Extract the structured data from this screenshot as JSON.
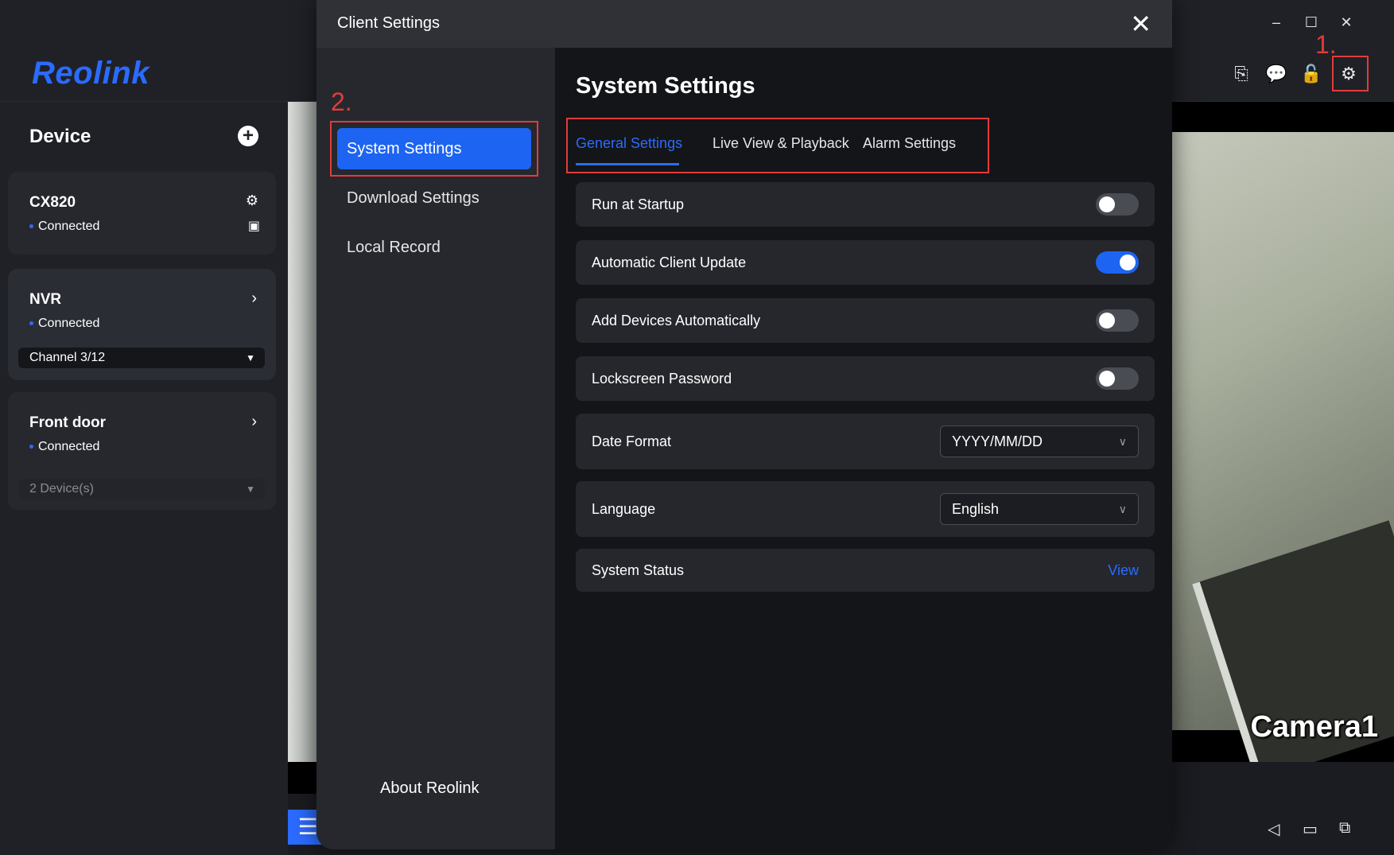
{
  "app": {
    "logo": "Reolink",
    "window_controls": {
      "minimize": "–",
      "maximize": "☐",
      "close": "✕"
    }
  },
  "sidebar": {
    "title": "Device",
    "devices": [
      {
        "name": "CX820",
        "status": "Connected"
      },
      {
        "name": "NVR",
        "status": "Connected",
        "select": "Channel 3/12"
      },
      {
        "name": "Front door",
        "status": "Connected",
        "select": "2 Device(s)"
      }
    ]
  },
  "video": {
    "camera_label": "Camera1"
  },
  "annotations": {
    "step1": "1.",
    "step2": "2."
  },
  "dialog": {
    "title": "Client Settings",
    "nav": {
      "active": "System Settings",
      "items": [
        "Download Settings",
        "Local Record"
      ],
      "about": "About Reolink"
    },
    "main": {
      "title": "System Settings",
      "tabs": [
        "General Settings",
        "Live View & Playback",
        "Alarm Settings"
      ],
      "active_tab": "General Settings",
      "settings": [
        {
          "label": "Run at Startup",
          "type": "toggle",
          "value": false
        },
        {
          "label": "Automatic Client Update",
          "type": "toggle",
          "value": true
        },
        {
          "label": "Add Devices Automatically",
          "type": "toggle",
          "value": false
        },
        {
          "label": "Lockscreen Password",
          "type": "toggle",
          "value": false
        },
        {
          "label": "Date Format",
          "type": "select",
          "value": "YYYY/MM/DD"
        },
        {
          "label": "Language",
          "type": "select",
          "value": "English"
        },
        {
          "label": "System Status",
          "type": "link",
          "value": "View"
        }
      ]
    }
  },
  "colors": {
    "accent": "#2b6bff",
    "highlight": "#e23b3b",
    "panel": "#25272d"
  }
}
